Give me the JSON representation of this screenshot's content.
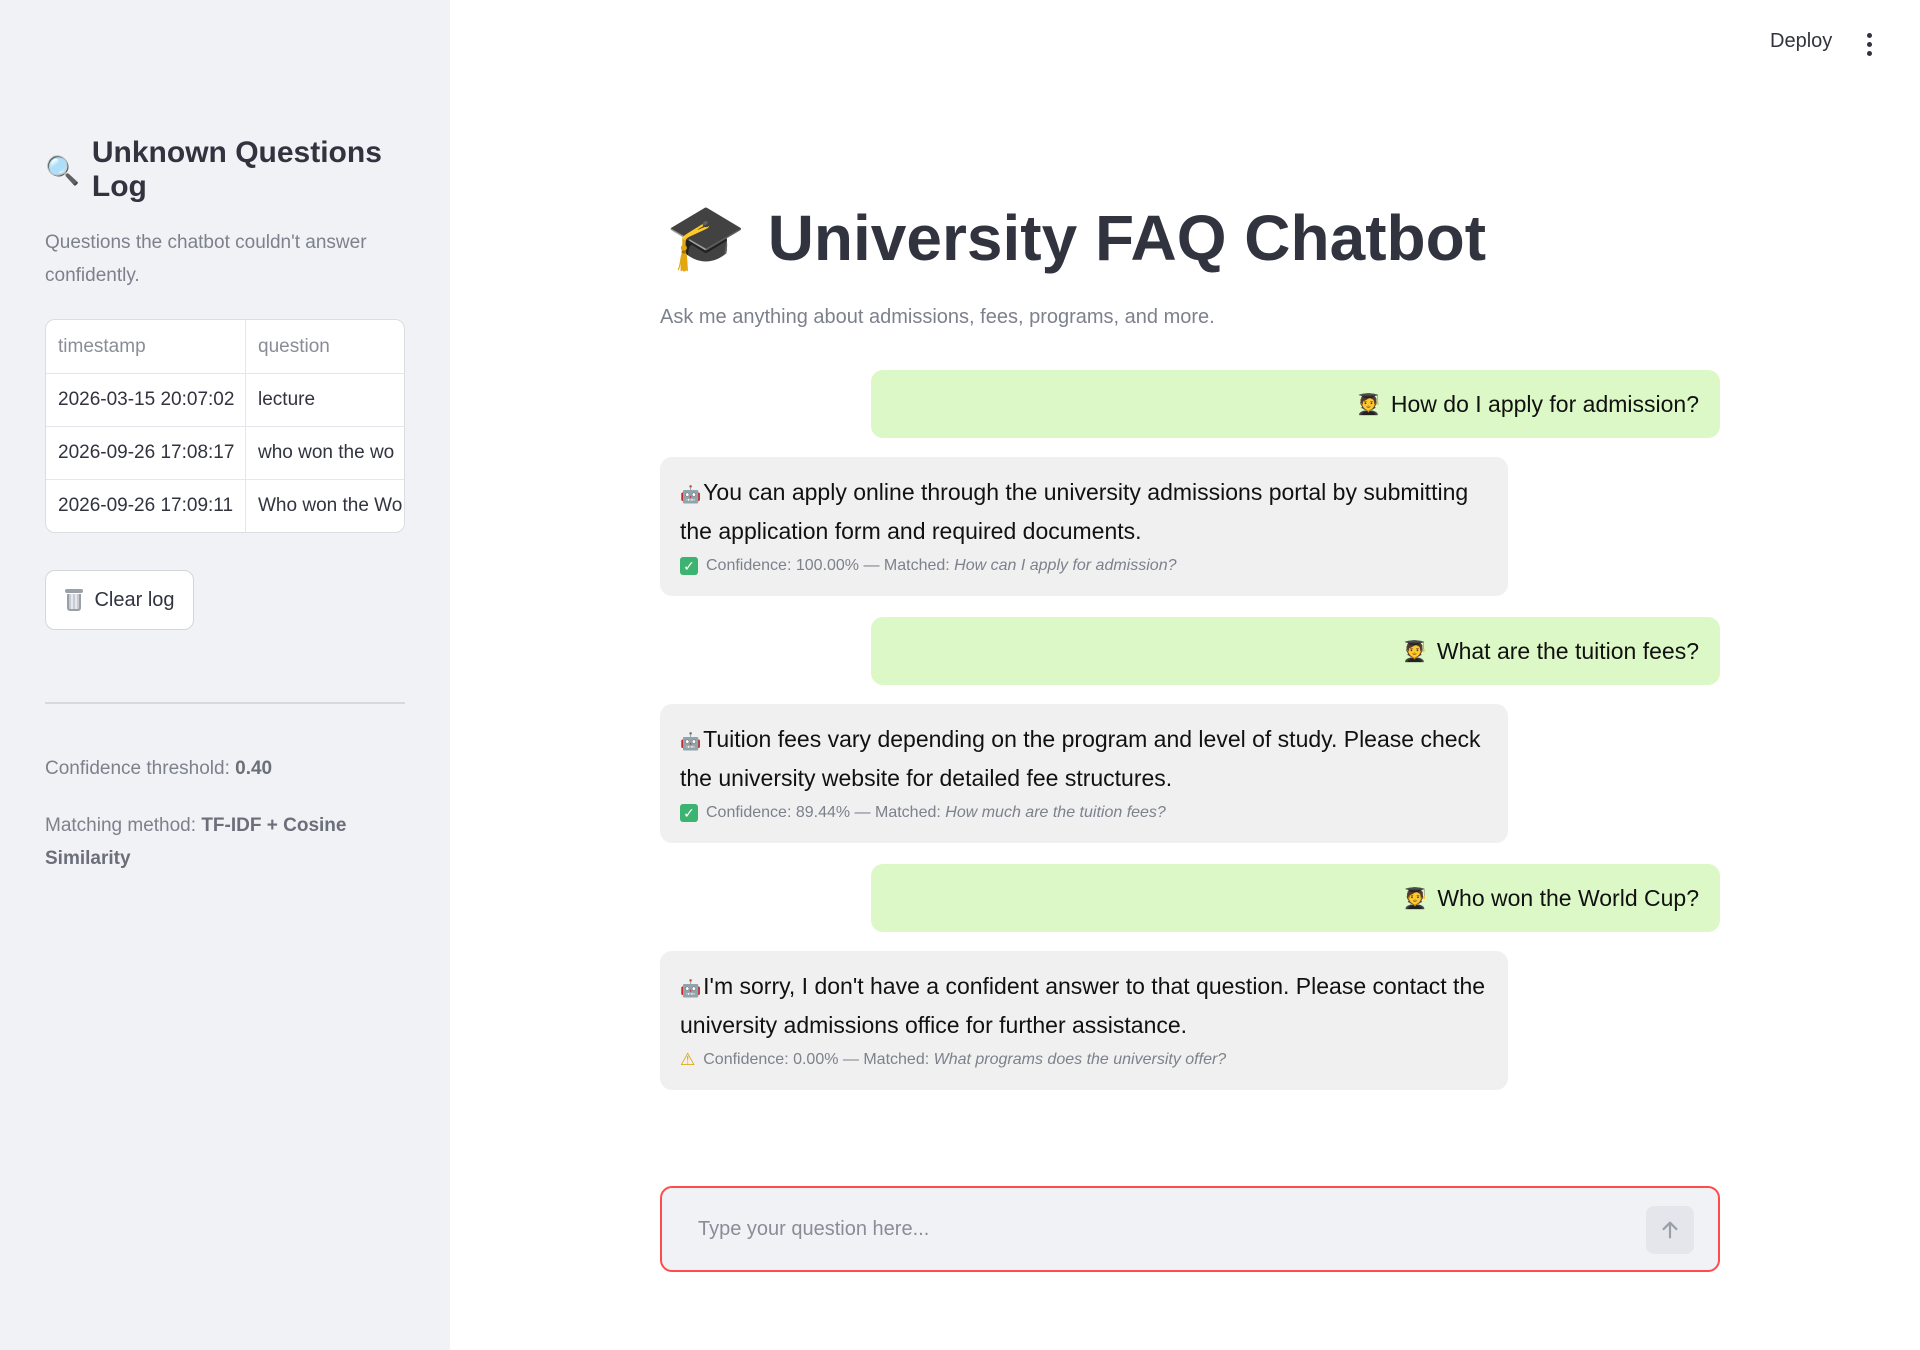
{
  "header": {
    "deploy_label": "Deploy"
  },
  "sidebar": {
    "title": "Unknown Questions Log",
    "description": "Questions the chatbot couldn't answer confidently.",
    "table": {
      "columns": [
        "timestamp",
        "question"
      ],
      "rows": [
        [
          "2026-03-15 20:07:02",
          "lecture"
        ],
        [
          "2026-09-26 17:08:17",
          "who won the wo"
        ],
        [
          "2026-09-26 17:09:11",
          "Who won the Wo"
        ]
      ]
    },
    "clear_label": "Clear log",
    "threshold_label": "Confidence threshold: ",
    "threshold_value": "0.40",
    "method_label": "Matching method: ",
    "method_value": "TF-IDF + Cosine Similarity"
  },
  "main": {
    "title": "University FAQ Chatbot",
    "subtitle": "Ask me anything about admissions, fees, programs, and more.",
    "messages": [
      {
        "role": "user",
        "text": "How do I apply for admission?"
      },
      {
        "role": "bot",
        "text": "You can apply online through the university admissions portal by submitting the application form and required documents.",
        "confidence": "Confidence: 100.00% — Matched: ",
        "matched": "How can I apply for admission?",
        "status": "ok"
      },
      {
        "role": "user",
        "text": "What are the tuition fees?"
      },
      {
        "role": "bot",
        "text": "Tuition fees vary depending on the program and level of study. Please check the university website for detailed fee structures.",
        "confidence": "Confidence: 89.44% — Matched: ",
        "matched": "How much are the tuition fees?",
        "status": "ok"
      },
      {
        "role": "user",
        "text": "Who won the World Cup?"
      },
      {
        "role": "bot",
        "text": "I'm sorry, I don't have a confident answer to that question. Please contact the university admissions office for further assistance.",
        "confidence": "Confidence: 0.00% — Matched: ",
        "matched": "What programs does the university offer?",
        "status": "warning"
      }
    ],
    "input_placeholder": "Type your question here..."
  },
  "colors": {
    "accent": "#ff4b4b",
    "user_bubble": "#dcf8c6",
    "bot_bubble": "#f0f0f0",
    "sidebar_bg": "#f0f2f6"
  },
  "icons": {
    "sidebar_title": "magnifier-icon",
    "title": "graduation-cap-icon",
    "user_avatar": "student-icon",
    "bot": "bot-icon",
    "ok": "check-icon",
    "warning": "warning-icon",
    "clear": "trash-icon",
    "send": "arrow-up-icon",
    "menu": "kebab-menu-icon"
  }
}
